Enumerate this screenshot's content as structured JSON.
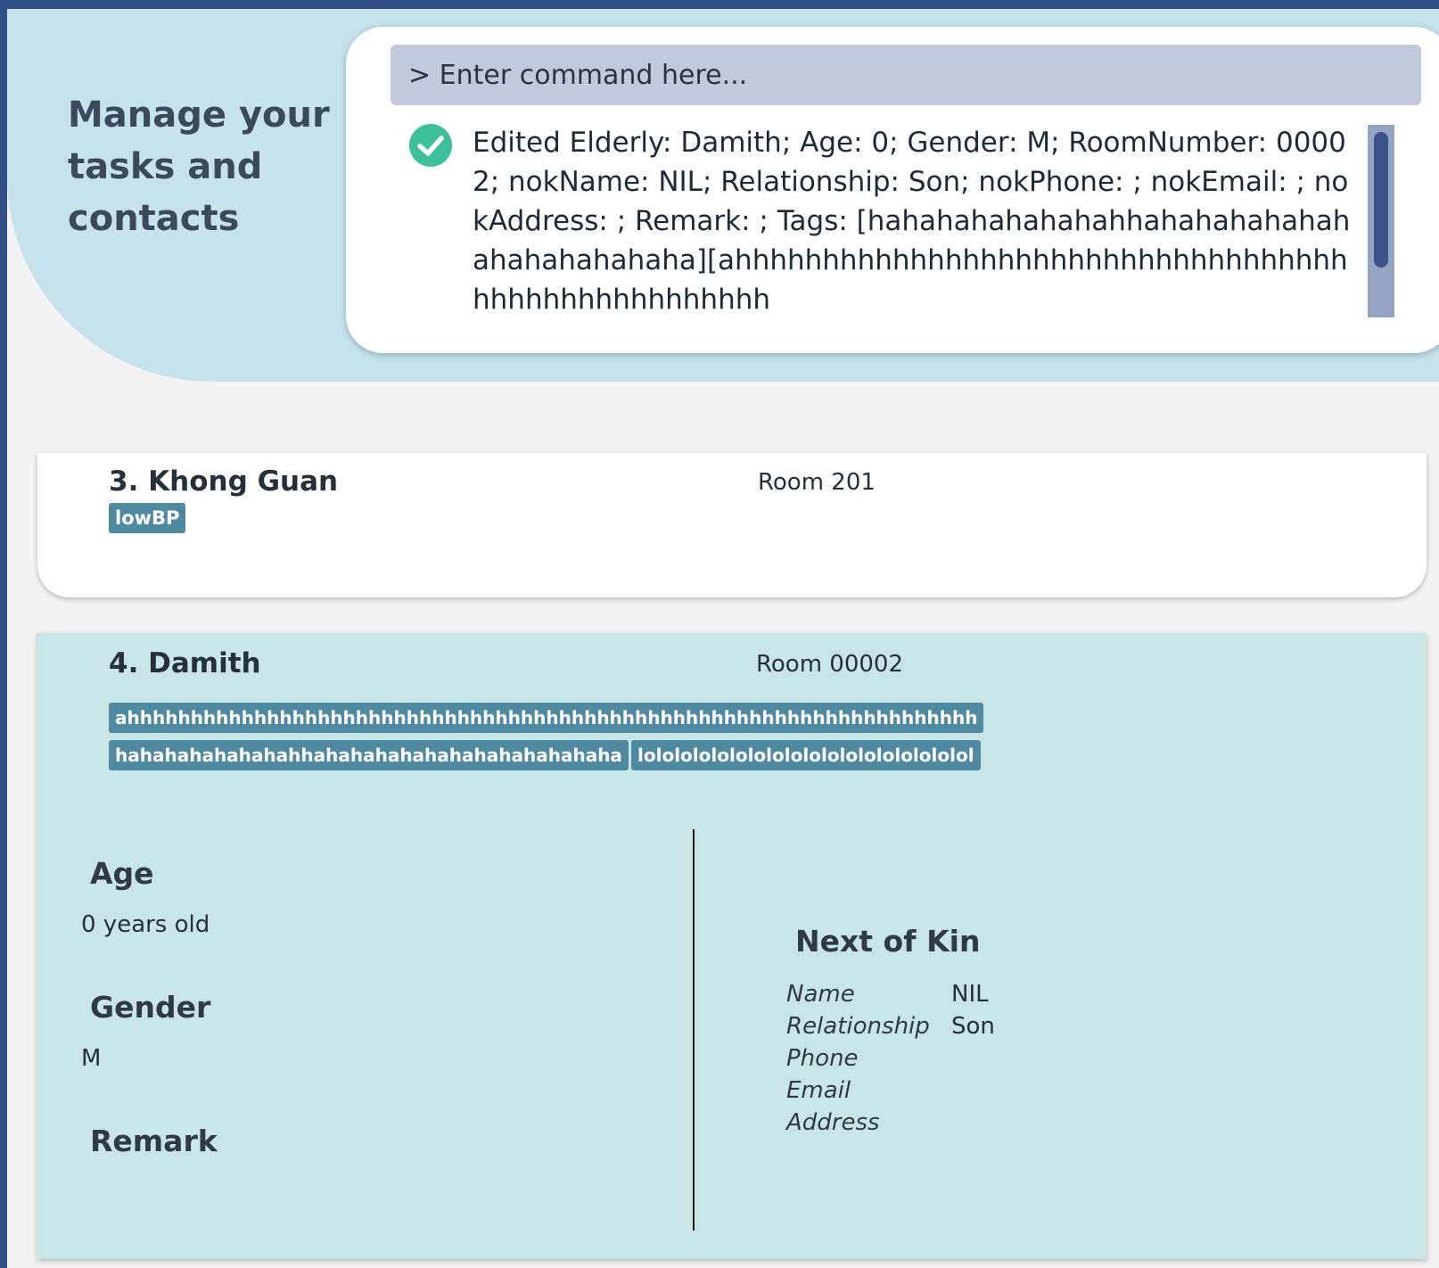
{
  "hero": {
    "title": "Manage your tasks and contacts"
  },
  "command": {
    "placeholder": "> Enter command here...",
    "result_status_icon": "check-circle-icon",
    "result_text": "Edited Elderly: Damith; Age: 0; Gender: M; RoomNumber: 00002; nokName: NIL; Relationship: Son; nokPhone: ; nokEmail: ; nokAddress: ; Remark: ; Tags: [hahahahahahahahhahahahahahahahahahahahaha][ahhhhhhhhhhhhhhhhhhhhhhhhhhhhhhhhhhhhhhhhhhhhhhhhhhhh",
    "colors": {
      "success": "#3dbf9a",
      "input_bg": "#c2c9dc",
      "scrollbar": "#3b5188"
    }
  },
  "elderly_list": [
    {
      "index_name": "3. Khong Guan",
      "room": "Room 201",
      "tags": [
        "lowBP"
      ]
    },
    {
      "index_name": "4. Damith",
      "room": "Room 00002",
      "tags": [
        "ahhhhhhhhhhhhhhhhhhhhhhhhhhhhhhhhhhhhhhhhhhhhhhhhhhhhhhhhhhhhhhhhhhh",
        "hahahahahahahahhahahahahahahahahahahahaha",
        "lolololololololololololololololololol"
      ],
      "details": {
        "age_label": "Age",
        "age_value": "0 years old",
        "gender_label": "Gender",
        "gender_value": "M",
        "remark_label": "Remark",
        "remark_value": "",
        "nok_title": "Next of Kin",
        "nok_fields": [
          {
            "label": "Name",
            "value": "NIL"
          },
          {
            "label": "Relationship",
            "value": "Son"
          },
          {
            "label": "Phone",
            "value": ""
          },
          {
            "label": "Email",
            "value": ""
          },
          {
            "label": "Address",
            "value": ""
          }
        ]
      }
    }
  ],
  "colors": {
    "frame": "#2f4f86",
    "hero_bg": "#c6e3ec",
    "selected_card_bg": "#c7e6e5",
    "tag_bg": "#4f8aa0"
  }
}
